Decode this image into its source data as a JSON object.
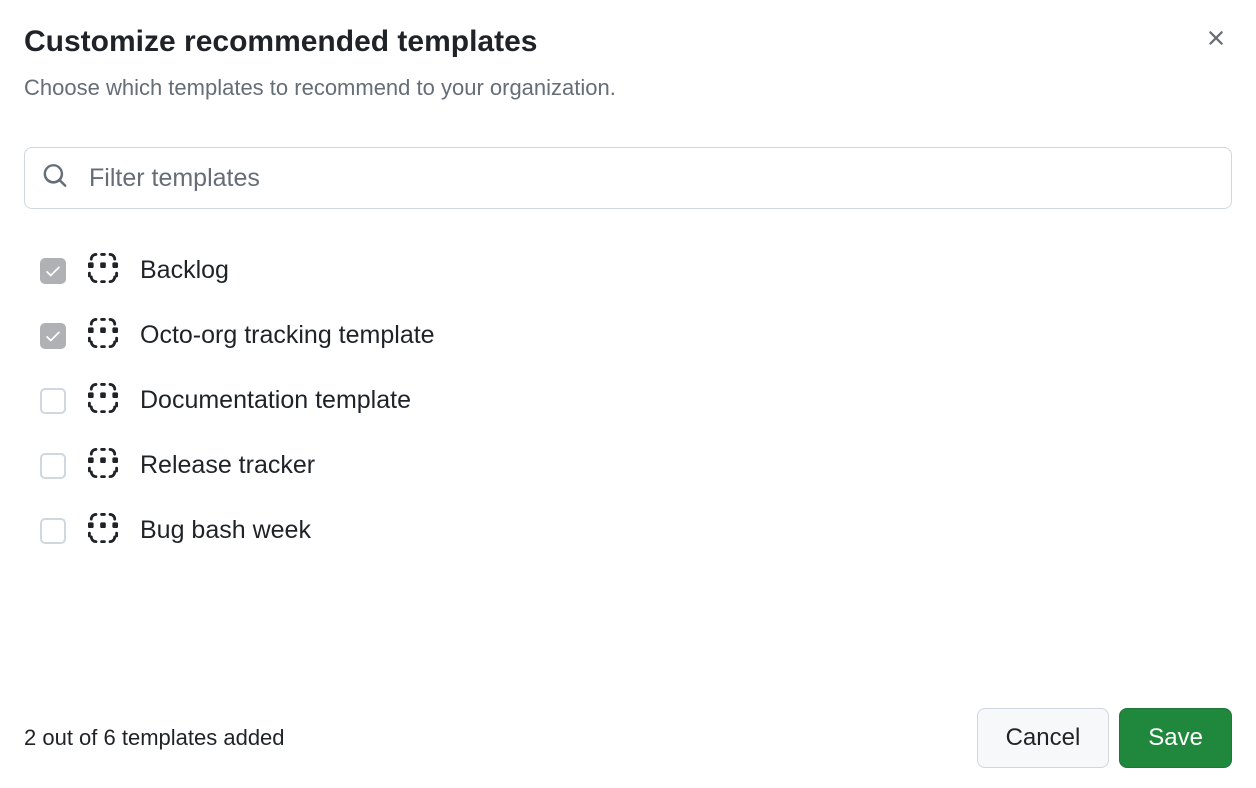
{
  "header": {
    "title": "Customize recommended templates",
    "subtitle": "Choose which templates to recommend to your organization."
  },
  "search": {
    "placeholder": "Filter templates",
    "value": ""
  },
  "templates": [
    {
      "label": "Backlog",
      "checked": true
    },
    {
      "label": "Octo-org tracking template",
      "checked": true
    },
    {
      "label": "Documentation template",
      "checked": false
    },
    {
      "label": "Release tracker",
      "checked": false
    },
    {
      "label": "Bug bash week",
      "checked": false
    }
  ],
  "footer": {
    "status": "2 out of 6 templates added",
    "cancel_label": "Cancel",
    "save_label": "Save"
  }
}
